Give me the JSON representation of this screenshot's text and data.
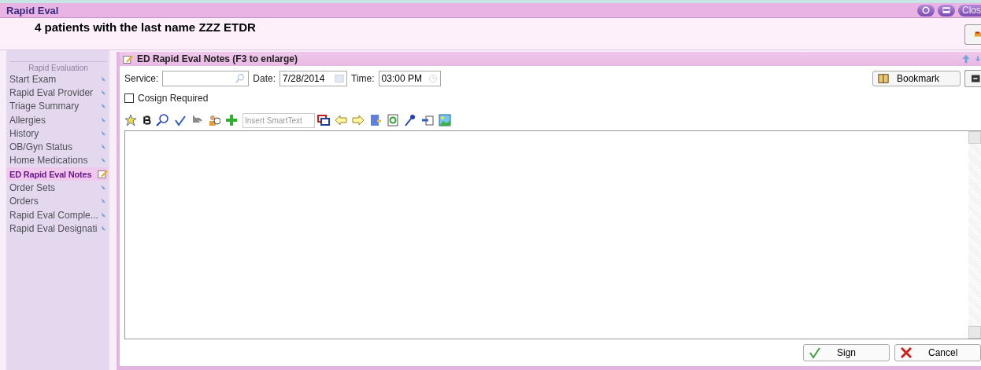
{
  "window": {
    "title": "Rapid Eval",
    "close_label": "Clos"
  },
  "header": {
    "title": "4 patients with the last name ZZZ ETDR"
  },
  "sidebar": {
    "heading": "Rapid Evaluation",
    "items": [
      {
        "label": "Start Exam",
        "selected": false
      },
      {
        "label": "Rapid Eval Provider",
        "selected": false
      },
      {
        "label": "Triage Summary",
        "selected": false
      },
      {
        "label": "Allergies",
        "selected": false
      },
      {
        "label": "History",
        "selected": false
      },
      {
        "label": "OB/Gyn Status",
        "selected": false
      },
      {
        "label": "Home Medications",
        "selected": false
      },
      {
        "label": "ED Rapid Eval Notes",
        "selected": true
      },
      {
        "label": "Order Sets",
        "selected": false
      },
      {
        "label": "Orders",
        "selected": false
      },
      {
        "label": "Rapid Eval Comple...",
        "selected": false
      },
      {
        "label": "Rapid Eval Designati",
        "selected": false
      }
    ]
  },
  "panel": {
    "title": "ED Rapid Eval Notes (F3 to enlarge)",
    "service": {
      "label": "Service:"
    },
    "date": {
      "label": "Date:",
      "value": "7/28/2014"
    },
    "time": {
      "label": "Time:",
      "value": "03:00 PM"
    },
    "bookmark": "Bookmark",
    "cosign": {
      "label": "Cosign Required",
      "checked": false
    },
    "smarttext": {
      "placeholder": "Insert SmartText"
    },
    "buttons": {
      "sign": "Sign",
      "cancel": "Cancel"
    }
  }
}
